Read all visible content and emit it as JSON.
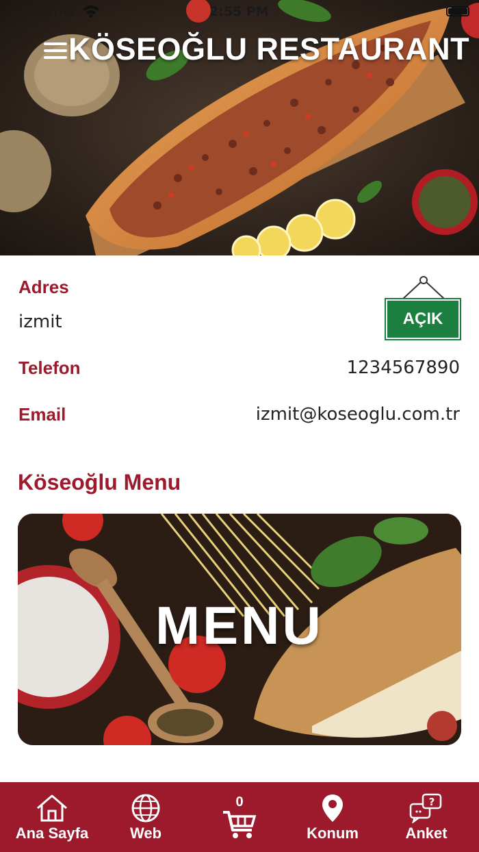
{
  "status_bar": {
    "carrier": "Carrier",
    "time": "2:55 PM"
  },
  "header": {
    "title": "KÖSEOĞLU RESTAURANT",
    "menu_icon": "hamburger-icon"
  },
  "info": {
    "address_label": "Adres",
    "address_value": "izmit",
    "phone_label": "Telefon",
    "phone_value": "1234567890",
    "email_label": "Email",
    "email_value": "izmit@koseoglu.com.tr",
    "open_status": "AÇIK"
  },
  "menu_section": {
    "title": "Köseoğlu Menu",
    "card_text": "MENU"
  },
  "tabbar": {
    "cart_count": "0",
    "items": [
      {
        "label": "Ana Sayfa",
        "icon": "home-icon"
      },
      {
        "label": "Web",
        "icon": "globe-icon"
      },
      {
        "label": "",
        "icon": "cart-icon"
      },
      {
        "label": "Konum",
        "icon": "location-pin-icon"
      },
      {
        "label": "Anket",
        "icon": "chat-question-icon"
      }
    ]
  },
  "colors": {
    "brand": "#9c1a2c",
    "open_green": "#1a7f3f"
  }
}
